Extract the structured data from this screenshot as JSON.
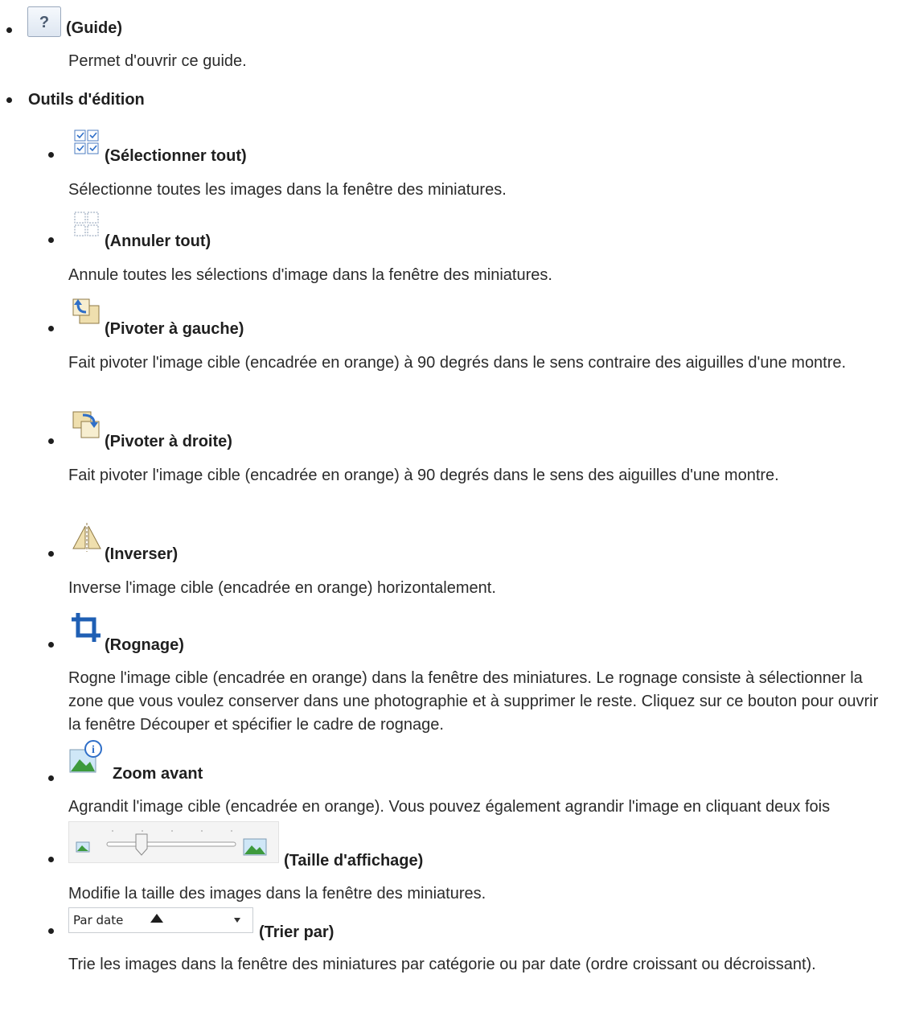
{
  "guide": {
    "icon": "question-mark-icon",
    "title": "(Guide)",
    "desc": "Permet d'ouvrir ce guide."
  },
  "section": {
    "title": "Outils d'édition"
  },
  "tools": [
    {
      "icon": "select-all-icon",
      "title": "(Sélectionner tout)",
      "desc": "Sélectionne toutes les images dans la fenêtre des miniatures."
    },
    {
      "icon": "cancel-all-icon",
      "title": "(Annuler tout)",
      "desc": "Annule toutes les sélections d'image dans la fenêtre des miniatures."
    },
    {
      "icon": "rotate-left-icon",
      "title": "(Pivoter à gauche)",
      "desc": "Fait pivoter l'image cible (encadrée en orange) à 90 degrés dans le sens contraire des aiguilles d'une montre."
    },
    {
      "icon": "rotate-right-icon",
      "title": "(Pivoter à droite)",
      "desc": "Fait pivoter l'image cible (encadrée en orange) à 90 degrés dans le sens des aiguilles d'une montre."
    },
    {
      "icon": "flip-icon",
      "title": "(Inverser)",
      "desc": "Inverse l'image cible (encadrée en orange) horizontalement."
    },
    {
      "icon": "crop-icon",
      "title": "(Rognage)",
      "desc": "Rogne l'image cible (encadrée en orange) dans la fenêtre des miniatures. Le rognage consiste à sélectionner la zone que vous voulez conserver dans une photographie et à supprimer le reste. Cliquez sur ce bouton pour ouvrir la fenêtre Découper et spécifier le cadre de rognage."
    },
    {
      "icon": "zoom-in-icon",
      "title": "Zoom avant",
      "desc": "Agrandit l'image cible (encadrée en orange). Vous pouvez également agrandir l'image en cliquant deux fois dessus."
    },
    {
      "icon": "display-size-slider",
      "title": "(Taille d'affichage)",
      "desc": "Modifie la taille des images dans la fenêtre des miniatures.",
      "slider_level": 0.25
    },
    {
      "icon": "sort-dropdown",
      "title": "(Trier par)",
      "desc": "Trie les images dans la fenêtre des miniatures par catégorie ou par date (ordre croissant ou décroissant).",
      "select_value": "Par date"
    }
  ],
  "colors": {
    "text": "#2b2b2b",
    "icon_blue": "#3f78c4",
    "icon_tan": "#d8c08a",
    "button_border": "#9aa9bd"
  }
}
